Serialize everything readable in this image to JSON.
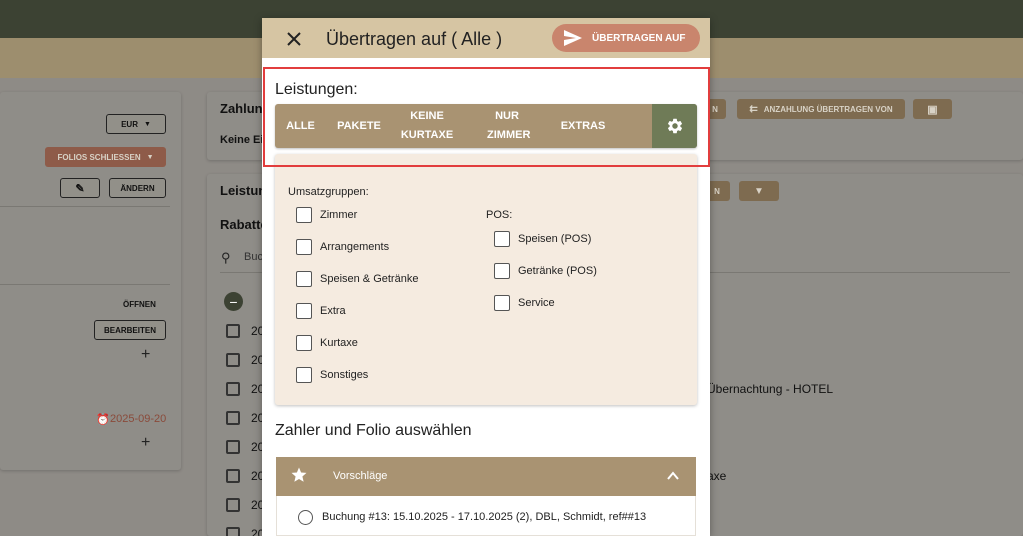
{
  "background": {
    "currency": "EUR",
    "close_folios": "FOLIOS SCHLIESSEN",
    "change": "ÄNDERN",
    "open": "ÖFFNEN",
    "edit": "BEARBEITEN",
    "date": "2025-09-20",
    "payer_card_title": "Zahlun",
    "payer_card_text": "Keine Ei",
    "deposit_transfer_from": "ANZAHLUNG ÜBERTRAGEN VON",
    "services_card_title": "Leistun",
    "rebates_title": "Rabatte",
    "search_placeholder": "Buch",
    "row_year": "20",
    "row_text_1": "Übernachtung - HOTEL",
    "row_text_2": "axe",
    "partial_btn": "N"
  },
  "dialog": {
    "title": "Übertragen auf ( Alle )",
    "transfer_button": "ÜBERTRAGEN AUF",
    "services_label": "Leistungen:",
    "filters": [
      {
        "label": "ALLE"
      },
      {
        "label": "PAKETE"
      },
      {
        "label": "KEINE KURTAXE"
      },
      {
        "label": "NUR ZIMMER"
      },
      {
        "label": "EXTRAS"
      }
    ],
    "revenue_groups_label": "Umsatzgruppen:",
    "revenue_groups": [
      "Zimmer",
      "Arrangements",
      "Speisen & Getränke",
      "Extra",
      "Kurtaxe",
      "Sonstiges"
    ],
    "pos_label": "POS:",
    "pos_groups": [
      "Speisen (POS)",
      "Getränke (POS)",
      "Service"
    ],
    "payer_section_title": "Zahler und Folio auswählen",
    "suggestions_title": "Vorschläge",
    "suggestion_1": "Buchung #13: 15.10.2025 - 17.10.2025 (2), DBL, Schmidt, ref##13"
  },
  "colors": {
    "header_bg": "#d6c5a3",
    "accent_brown": "#a99372",
    "settings_green": "#6f7b57",
    "transfer_btn": "#c9856d",
    "highlight": "#e23d3d",
    "panel_bg": "#f5ebe0"
  }
}
